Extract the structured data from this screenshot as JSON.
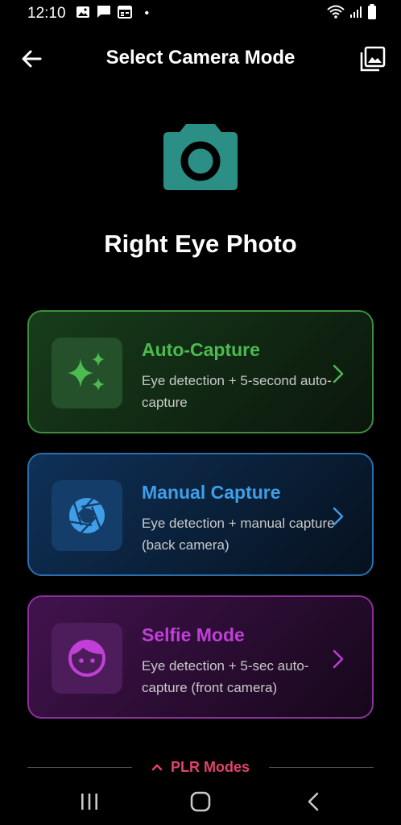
{
  "status_bar": {
    "time": "12:10",
    "dot": "•",
    "icons": [
      "image-notification-icon",
      "message-notification-icon",
      "calendar-notification-icon",
      "wifi-icon",
      "signal-icon",
      "battery-icon"
    ]
  },
  "app_bar": {
    "title": "Select Camera Mode",
    "back_icon": "arrow-left-icon",
    "gallery_icon": "gallery-icon"
  },
  "header": {
    "icon": "camera-icon",
    "title": "Right Eye Photo",
    "accent": "#2b8f86"
  },
  "modes": [
    {
      "title": "Auto-Capture",
      "description": "Eye detection + 5-second auto-capture",
      "icon": "sparkles-icon",
      "color": "#4cbb50"
    },
    {
      "title": "Manual Capture",
      "description": "Eye detection + manual capture (back camera)",
      "icon": "camera-shutter-icon",
      "color": "#3f9ee8"
    },
    {
      "title": "Selfie Mode",
      "description": "Eye detection + 5-sec auto-capture (front camera)",
      "icon": "face-icon",
      "color": "#c13fd8"
    }
  ],
  "plr": {
    "label": "PLR Modes",
    "icon": "chevron-up-icon",
    "color": "#e0446a"
  },
  "nav_bar": {
    "icons": [
      "recent-apps-icon",
      "home-icon",
      "back-icon"
    ]
  }
}
